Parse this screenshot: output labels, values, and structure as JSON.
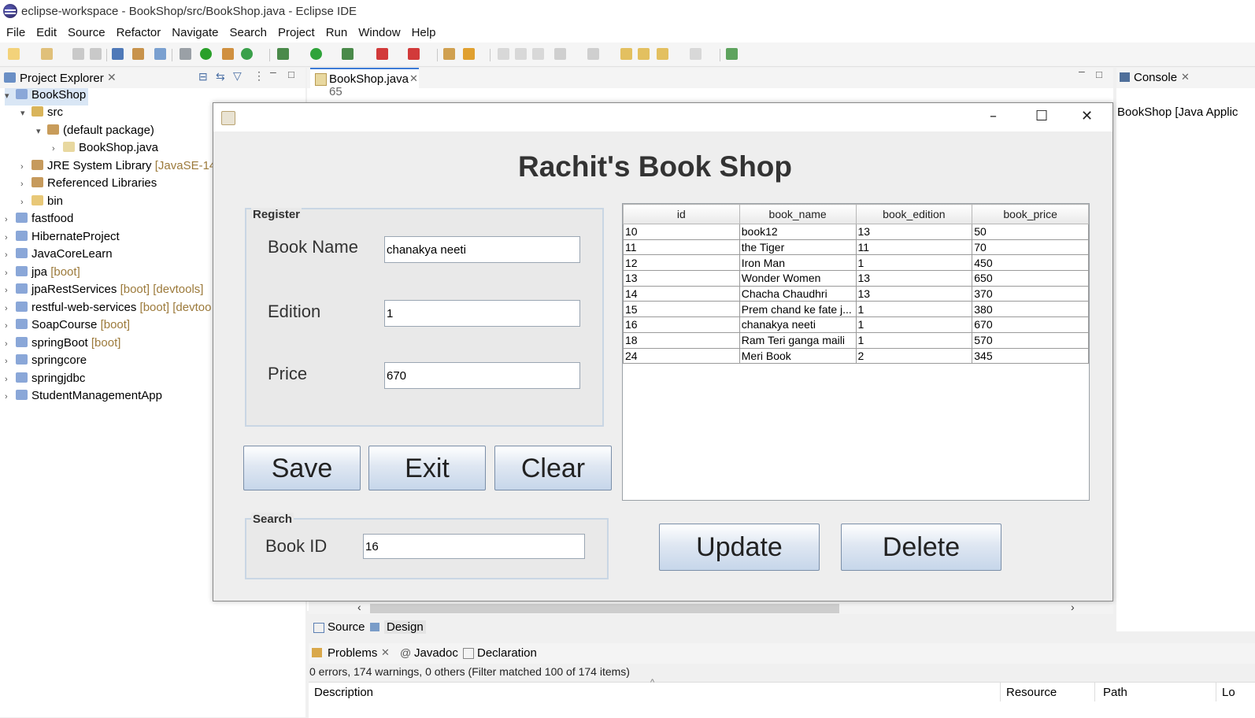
{
  "window": {
    "title": "eclipse-workspace - BookShop/src/BookShop.java - Eclipse IDE"
  },
  "menu": [
    "File",
    "Edit",
    "Source",
    "Refactor",
    "Navigate",
    "Search",
    "Project",
    "Run",
    "Window",
    "Help"
  ],
  "project_explorer": {
    "title": "Project Explorer",
    "nodes": [
      {
        "label": "BookShop",
        "deco": ""
      },
      {
        "label": "src",
        "deco": ""
      },
      {
        "label": "(default package)",
        "deco": ""
      },
      {
        "label": "BookShop.java",
        "deco": ""
      },
      {
        "label": "JRE System Library",
        "deco": "[JavaSE-14]"
      },
      {
        "label": "Referenced Libraries",
        "deco": ""
      },
      {
        "label": "bin",
        "deco": ""
      },
      {
        "label": "fastfood",
        "deco": ""
      },
      {
        "label": "HibernateProject",
        "deco": ""
      },
      {
        "label": "JavaCoreLearn",
        "deco": ""
      },
      {
        "label": "jpa",
        "deco": "[boot]"
      },
      {
        "label": "jpaRestServices",
        "deco": "[boot] [devtools]"
      },
      {
        "label": "restful-web-services",
        "deco": "[boot] [devtoo"
      },
      {
        "label": "SoapCourse",
        "deco": "[boot]"
      },
      {
        "label": "springBoot",
        "deco": "[boot]"
      },
      {
        "label": "springcore",
        "deco": ""
      },
      {
        "label": "springjdbc",
        "deco": ""
      },
      {
        "label": "StudentManagementApp",
        "deco": ""
      }
    ]
  },
  "editor": {
    "tab": "BookShop.java",
    "line_number": "65",
    "source_tab": "Source",
    "design_tab": "Design"
  },
  "console": {
    "tab": "Console",
    "text": "BookShop [Java Applic"
  },
  "problems": {
    "tabs": [
      "Problems",
      "Javadoc",
      "Declaration"
    ],
    "status": "0 errors, 174 warnings, 0 others (Filter matched 100 of 174 items)",
    "columns": [
      "Description",
      "Resource",
      "Path",
      "Lo"
    ]
  },
  "app": {
    "title": "Rachit's Book Shop",
    "register": {
      "legend": "Register",
      "book_name_label": "Book Name",
      "book_name_value": "chanakya neeti",
      "edition_label": "Edition",
      "edition_value": "1",
      "price_label": "Price",
      "price_value": "670"
    },
    "buttons": {
      "save": "Save",
      "exit": "Exit",
      "clear": "Clear",
      "update": "Update",
      "delete": "Delete"
    },
    "search": {
      "legend": "Search",
      "book_id_label": "Book ID",
      "book_id_value": "16"
    },
    "table": {
      "columns": [
        "id",
        "book_name",
        "book_edition",
        "book_price"
      ],
      "rows": [
        [
          "10",
          "book12",
          "13",
          "50"
        ],
        [
          "11",
          "the Tiger",
          "11",
          "70"
        ],
        [
          "12",
          "Iron Man",
          "1",
          "450"
        ],
        [
          "13",
          "Wonder Women",
          "13",
          "650"
        ],
        [
          "14",
          "Chacha Chaudhri",
          "13",
          "370"
        ],
        [
          "15",
          "Prem chand ke fate j...",
          "1",
          "380"
        ],
        [
          "16",
          "chanakya neeti",
          "1",
          "670"
        ],
        [
          "18",
          "Ram Teri ganga maili",
          "1",
          "570"
        ],
        [
          "24",
          "Meri Book",
          "2",
          "345"
        ]
      ]
    }
  }
}
